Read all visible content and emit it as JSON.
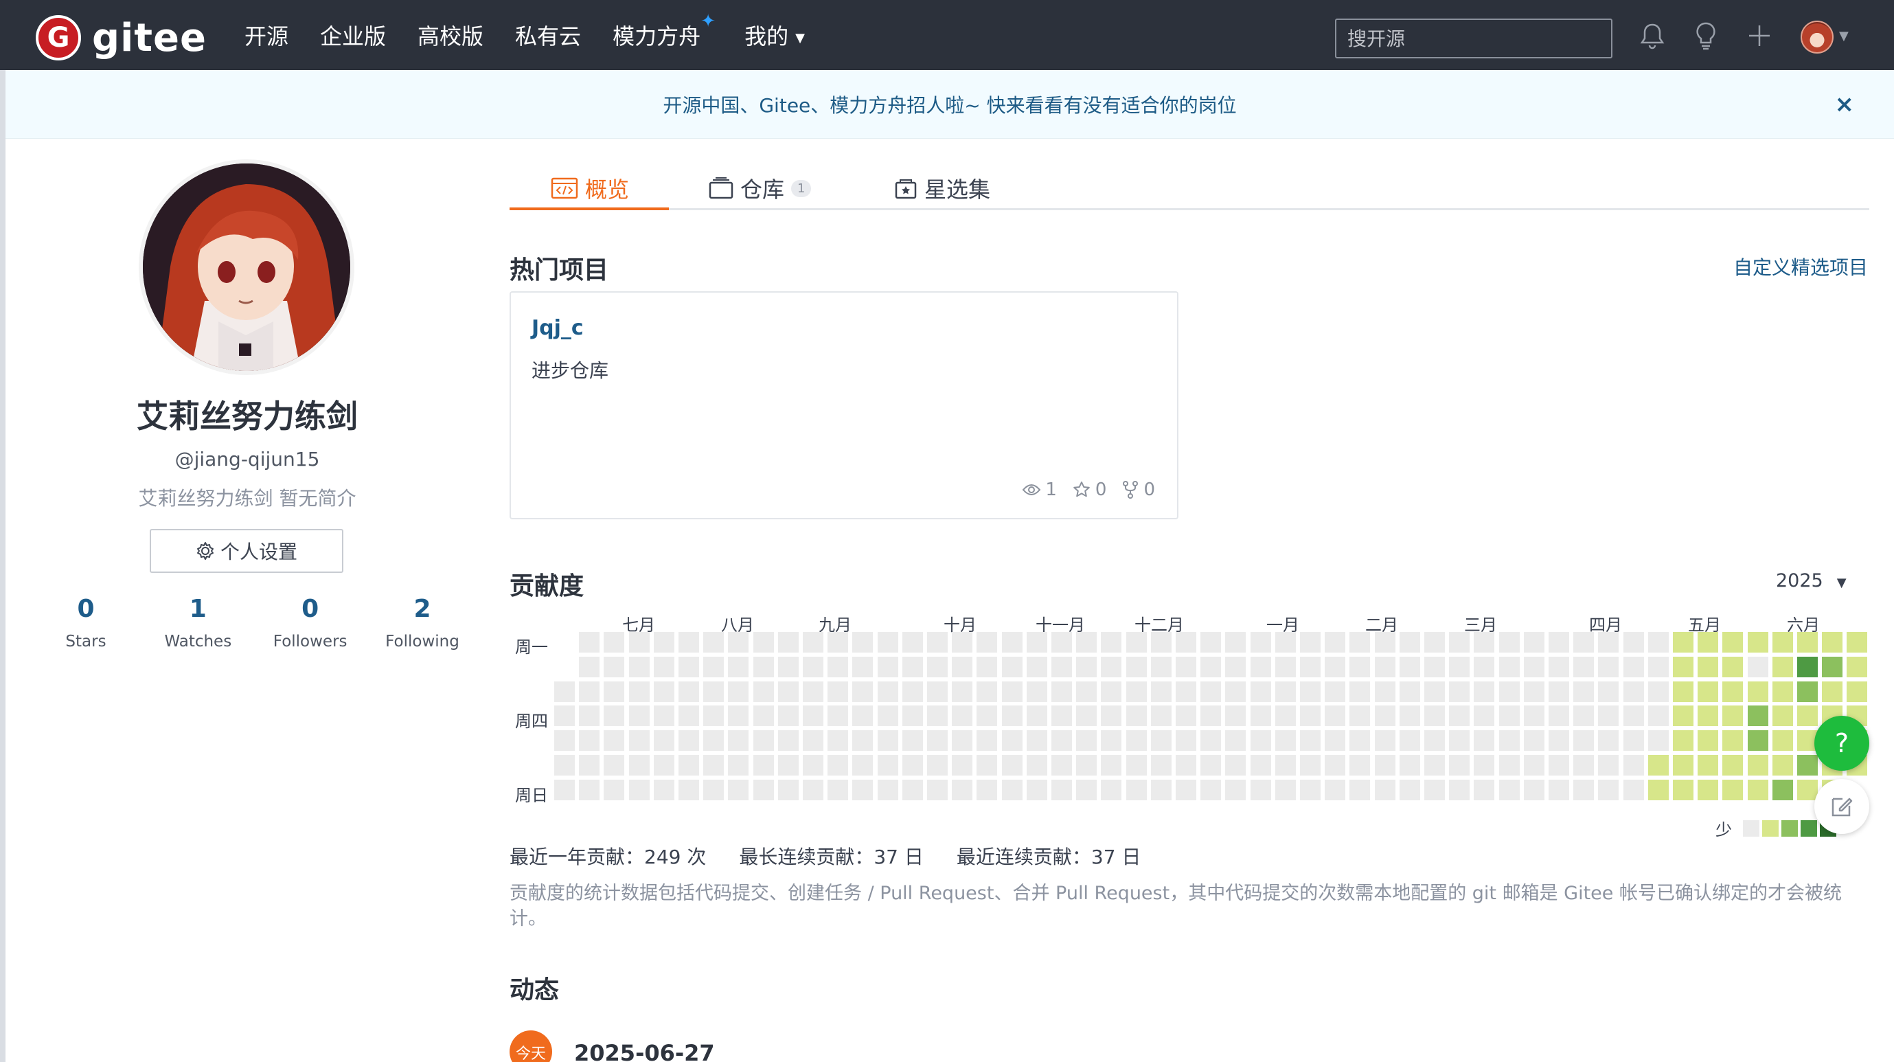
{
  "brand": {
    "logo_letter": "G",
    "name": "gitee"
  },
  "nav": {
    "items": [
      {
        "label": "开源"
      },
      {
        "label": "企业版"
      },
      {
        "label": "高校版"
      },
      {
        "label": "私有云"
      },
      {
        "label": "模力方舟"
      },
      {
        "label": "我的"
      }
    ],
    "search_placeholder": "搜开源"
  },
  "banner": {
    "text": "开源中国、Gitee、模力方舟招人啦~ 快来看看有没有适合你的岗位",
    "close": "×"
  },
  "profile": {
    "name": "艾莉丝努力练剑",
    "handle": "@jiang-qijun15",
    "bio": "艾莉丝努力练剑 暂无简介",
    "settings_label": "个人设置",
    "stats": [
      {
        "num": "0",
        "label": "Stars"
      },
      {
        "num": "1",
        "label": "Watches"
      },
      {
        "num": "0",
        "label": "Followers"
      },
      {
        "num": "2",
        "label": "Following"
      }
    ]
  },
  "tabs": [
    {
      "label": "概览"
    },
    {
      "label": "仓库",
      "badge": "1"
    },
    {
      "label": "星选集"
    }
  ],
  "hot_projects": {
    "title": "热门项目",
    "customize_link": "自定义精选项目",
    "project": {
      "name": "Jqj_c",
      "desc": "进步仓库",
      "watch": "1",
      "star": "0",
      "fork": "0"
    }
  },
  "contribution": {
    "title": "贡献度",
    "year": "2025",
    "months": [
      "七月",
      "八月",
      "九月",
      "十月",
      "十一月",
      "十二月",
      "一月",
      "二月",
      "三月",
      "四月",
      "五月",
      "六月"
    ],
    "days": [
      "周一",
      "周四",
      "周日"
    ],
    "legend_less": "少",
    "colors": {
      "empty": "#ebebeb",
      "l1": "#d7e68a",
      "l2": "#b4dc6a",
      "l3": "#8cc05e",
      "l4": "#4e9a43",
      "l5": "#2b6b2a"
    },
    "active_columns": [
      [
        null,
        null,
        null,
        null,
        null,
        1,
        1
      ],
      [
        1,
        1,
        1,
        1,
        1,
        1,
        1
      ],
      [
        1,
        1,
        1,
        1,
        1,
        1,
        1
      ],
      [
        1,
        1,
        1,
        1,
        1,
        1,
        1
      ],
      [
        1,
        null,
        1,
        3,
        3,
        1,
        1
      ],
      [
        1,
        1,
        1,
        1,
        1,
        1,
        3
      ],
      [
        1,
        4,
        3,
        1,
        1,
        3,
        1
      ],
      [
        1,
        3,
        1,
        1,
        1,
        1,
        1
      ],
      [
        1,
        1,
        1,
        1,
        1,
        1,
        null
      ]
    ],
    "summary": {
      "year_total": "最近一年贡献：249 次",
      "longest": "最长连续贡献：37 日",
      "recent": "最近连续贡献：37 日"
    },
    "note": "贡献度的统计数据包括代码提交、创建任务 / Pull Request、合并 Pull Request，其中代码提交的次数需本地配置的 git 邮箱是 Gitee 帐号已确认绑定的才会被统计。"
  },
  "activity": {
    "title": "动态",
    "today_badge": "今天",
    "date": "2025-06-27"
  },
  "fab": {
    "help": "?"
  }
}
